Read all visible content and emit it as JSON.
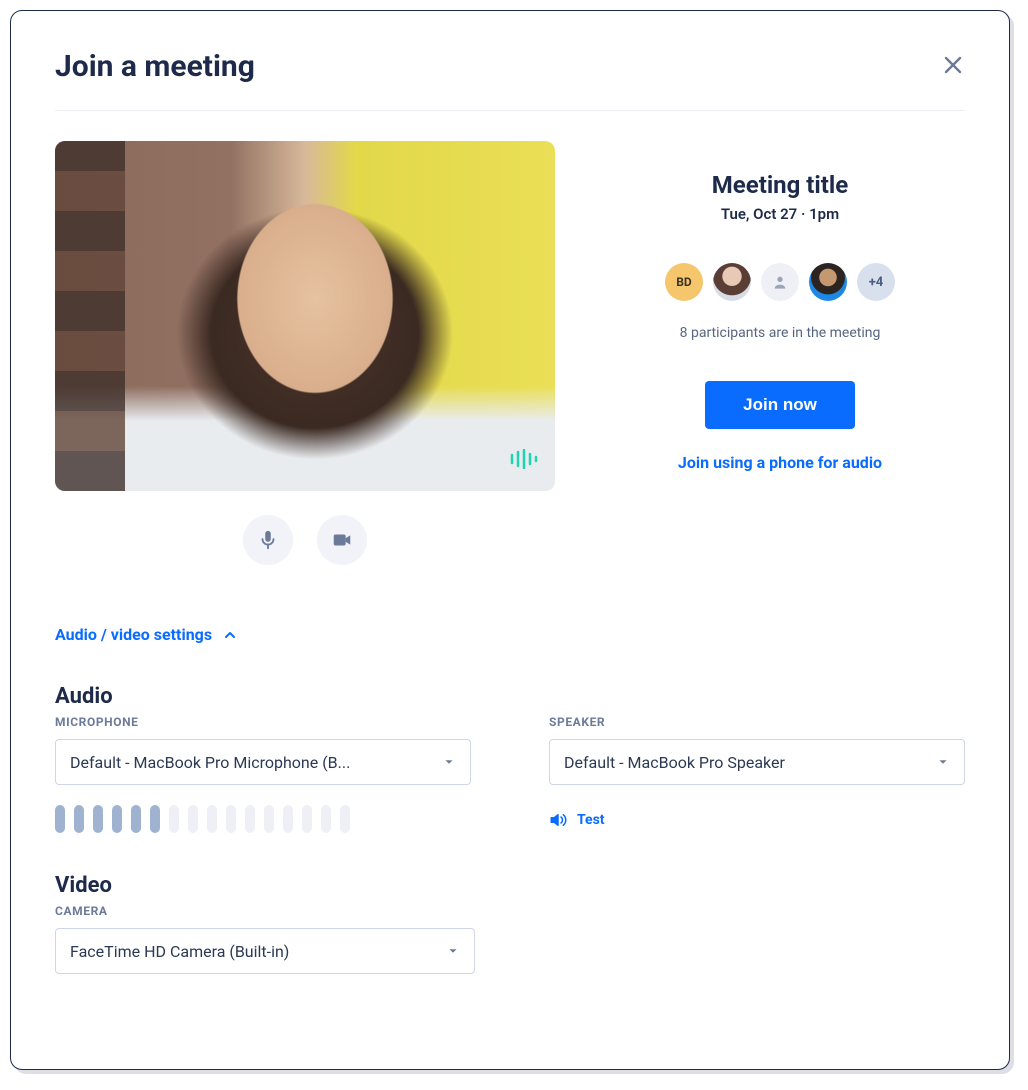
{
  "modal": {
    "title": "Join a meeting"
  },
  "meeting": {
    "title": "Meeting title",
    "datetime": "Tue, Oct 27 · 1pm",
    "participants_text": "8 participants are in the meeting",
    "avatar_initials": "BD",
    "avatar_more": "+4",
    "join_label": "Join now",
    "phone_label": "Join using a phone for audio"
  },
  "settings": {
    "toggle_label": "Audio / video settings",
    "audio_heading": "Audio",
    "microphone_label": "MICROPHONE",
    "microphone_value": "Default - MacBook Pro Microphone (B...",
    "speaker_label": "SPEAKER",
    "speaker_value": "Default - MacBook Pro Speaker",
    "speaker_test_label": "Test",
    "video_heading": "Video",
    "camera_label": "CAMERA",
    "camera_value": "FaceTime HD Camera (Built-in)",
    "mic_level": {
      "active": 6,
      "total": 16
    }
  }
}
